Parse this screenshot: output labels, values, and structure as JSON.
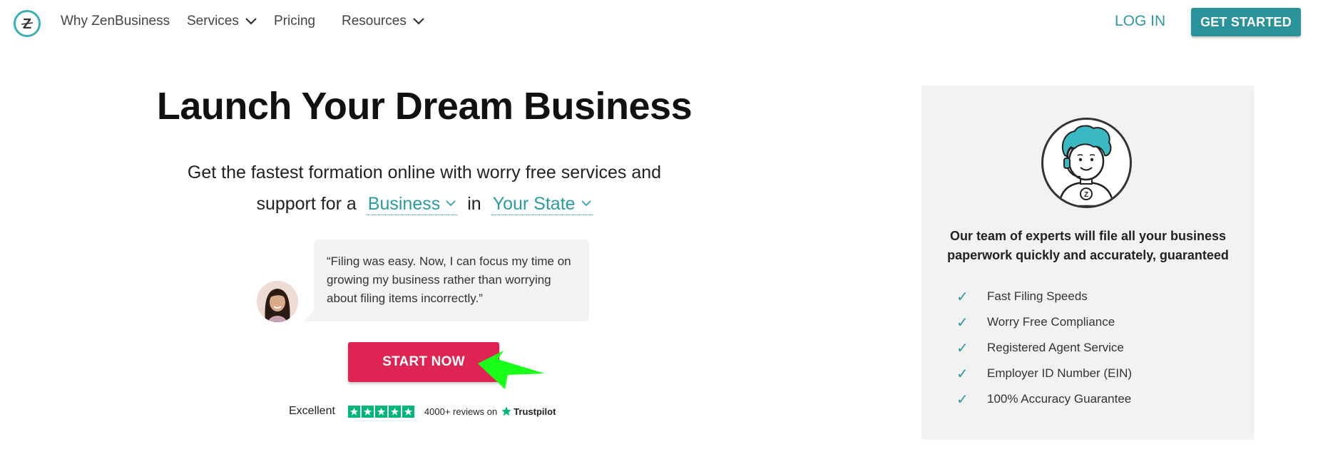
{
  "nav": {
    "items": [
      {
        "label": "Why ZenBusiness",
        "has_dropdown": false
      },
      {
        "label": "Services",
        "has_dropdown": true
      },
      {
        "label": "Pricing",
        "has_dropdown": false
      },
      {
        "label": "Resources",
        "has_dropdown": true
      }
    ],
    "login_label": "LOG IN",
    "get_started_label": "GET STARTED"
  },
  "hero": {
    "title": "Launch Your Dream Business",
    "subtitle_line1": "Get the fastest formation online with worry free services and",
    "subtitle_prefix": "support for a",
    "business_select": "Business",
    "subtitle_in": "in",
    "state_select": "Your State"
  },
  "testimonial": {
    "quote": "“Filing was easy. Now, I can focus my time on growing my business rather than worrying about filing items incorrectly.”"
  },
  "cta": {
    "start_now_label": "START NOW"
  },
  "trustpilot": {
    "rating_word": "Excellent",
    "stars": 5,
    "reviews_text": "4000+ reviews on",
    "brand": "Trustpilot"
  },
  "card": {
    "headline": "Our team of experts will file all your business paperwork quickly and accurately, guaranteed",
    "features": [
      "Fast Filing Speeds",
      "Worry Free Compliance",
      "Registered Agent Service",
      "Employer ID Number (EIN)",
      "100% Accuracy Guarantee"
    ]
  },
  "colors": {
    "teal": "#2a9aa3",
    "teal_button": "#2a9399",
    "cta_red": "#dd2453",
    "trustpilot_green": "#00b67a",
    "annotation_green": "#19ff19",
    "card_bg": "#f2f2f2"
  },
  "icons": {
    "logo": "zenbusiness-z-logo",
    "dropdown": "chevron-down-icon",
    "check": "check-icon",
    "agent": "support-agent-illustration",
    "annotation": "green-pointer-arrow"
  }
}
